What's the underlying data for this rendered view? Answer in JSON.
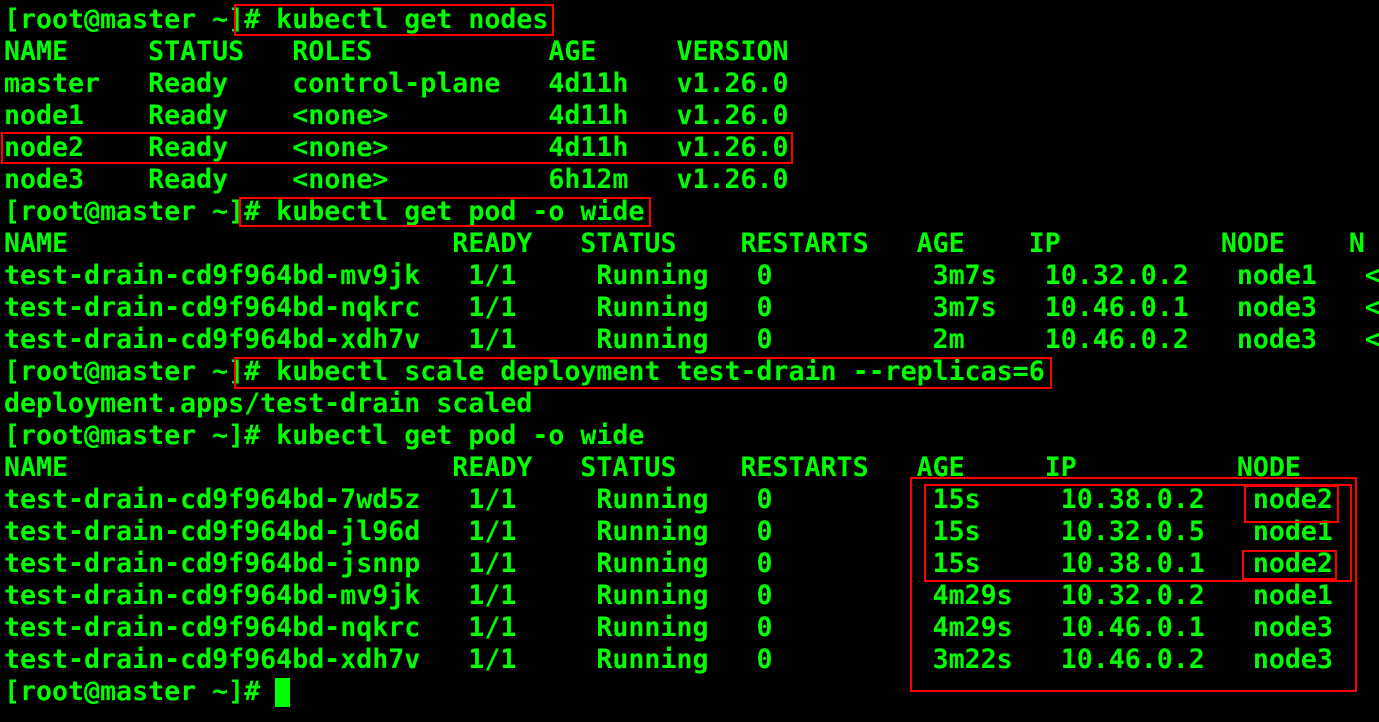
{
  "terminal": {
    "text_color": "#00ff00",
    "background_color": "#000000",
    "highlight_color": "#ff0000",
    "lines": [
      "[root@master ~]# kubectl get nodes",
      "NAME     STATUS   ROLES           AGE     VERSION",
      "master   Ready    control-plane   4d11h   v1.26.0",
      "node1    Ready    <none>          4d11h   v1.26.0",
      "node2    Ready    <none>          4d11h   v1.26.0",
      "node3    Ready    <none>          6h12m   v1.26.0",
      "[root@master ~]# kubectl get pod -o wide",
      "NAME                        READY   STATUS    RESTARTS   AGE    IP          NODE    N",
      "test-drain-cd9f964bd-mv9jk   1/1     Running   0          3m7s   10.32.0.2   node1   <",
      "test-drain-cd9f964bd-nqkrc   1/1     Running   0          3m7s   10.46.0.1   node3   <",
      "test-drain-cd9f964bd-xdh7v   1/1     Running   0          2m     10.46.0.2   node3   <",
      "[root@master ~]# kubectl scale deployment test-drain --replicas=6",
      "deployment.apps/test-drain scaled",
      "[root@master ~]# kubectl get pod -o wide",
      "NAME                        READY   STATUS    RESTARTS   AGE     IP          NODE",
      "test-drain-cd9f964bd-7wd5z   1/1     Running   0          15s     10.38.0.2   node2",
      "test-drain-cd9f964bd-jl96d   1/1     Running   0          15s     10.32.0.5   node1",
      "test-drain-cd9f964bd-jsnnp   1/1     Running   0          15s     10.38.0.1   node2",
      "test-drain-cd9f964bd-mv9jk   1/1     Running   0          4m29s   10.32.0.2   node1",
      "test-drain-cd9f964bd-nqkrc   1/1     Running   0          4m29s   10.46.0.1   node3",
      "test-drain-cd9f964bd-xdh7v   1/1     Running   0          3m22s   10.46.0.2   node3",
      "[root@master ~]# "
    ]
  }
}
